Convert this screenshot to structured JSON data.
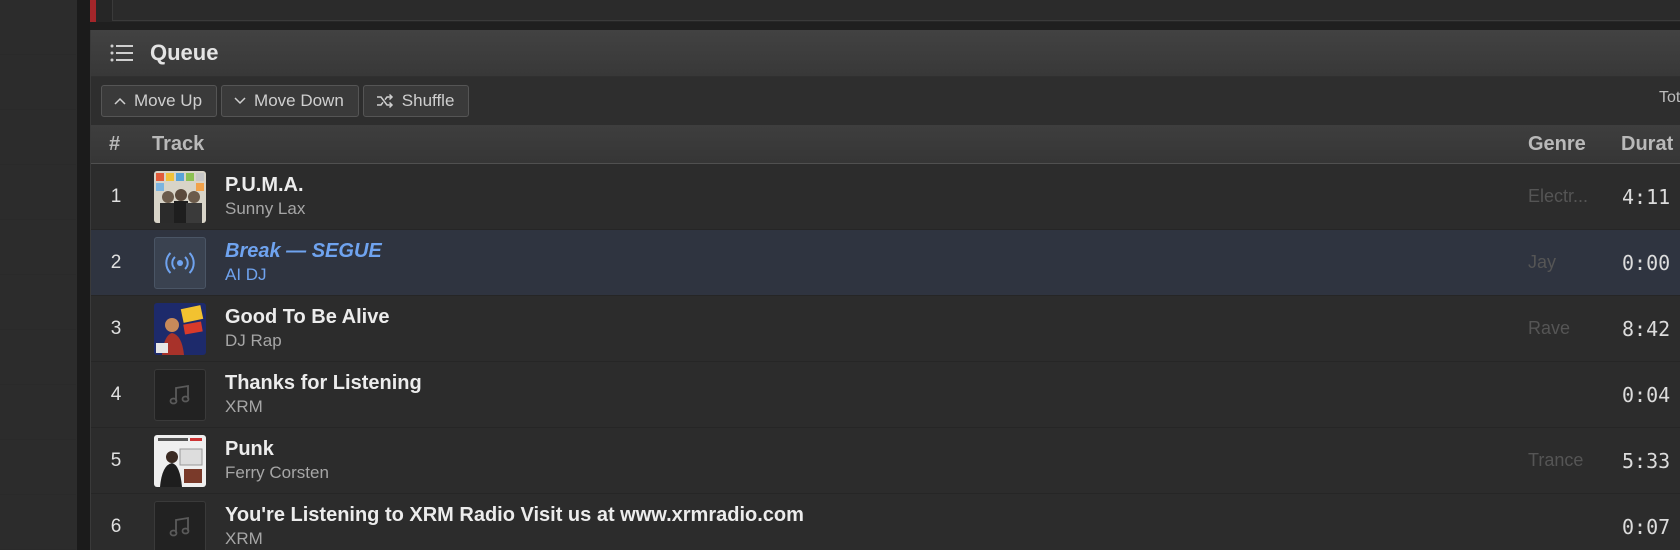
{
  "queue": {
    "title": "Queue",
    "icon": "list-icon"
  },
  "toolbar": {
    "move_up_label": "Move Up",
    "move_down_label": "Move Down",
    "shuffle_label": "Shuffle",
    "total_label": "Tot"
  },
  "columns": {
    "num": "#",
    "track": "Track",
    "genre": "Genre",
    "duration": "Durat"
  },
  "tracks": [
    {
      "num": "1",
      "title": "P.U.M.A.",
      "artist": "Sunny Lax",
      "genre": "Electr...",
      "duration": "4:11",
      "art": "album-art"
    },
    {
      "num": "2",
      "title": "Break — SEGUE",
      "artist": "AI DJ",
      "genre": "Jay",
      "duration": "0:00",
      "art": "radio-icon",
      "active": true
    },
    {
      "num": "3",
      "title": "Good To Be Alive",
      "artist": "DJ Rap",
      "genre": "Rave",
      "duration": "8:42",
      "art": "album-art"
    },
    {
      "num": "4",
      "title": "Thanks for Listening",
      "artist": "XRM",
      "genre": "",
      "duration": "0:04",
      "art": "music-note-icon"
    },
    {
      "num": "5",
      "title": "Punk",
      "artist": "Ferry Corsten",
      "genre": "Trance",
      "duration": "5:33",
      "art": "album-art"
    },
    {
      "num": "6",
      "title": "You're Listening to XRM Radio Visit us at www.xrmradio.com",
      "artist": "XRM",
      "genre": "",
      "duration": "0:07",
      "art": "music-note-icon"
    }
  ],
  "colors": {
    "accent_blue": "#6fa3ef",
    "red_accent": "#a3262a",
    "panel_bg": "#2c2c2c"
  }
}
